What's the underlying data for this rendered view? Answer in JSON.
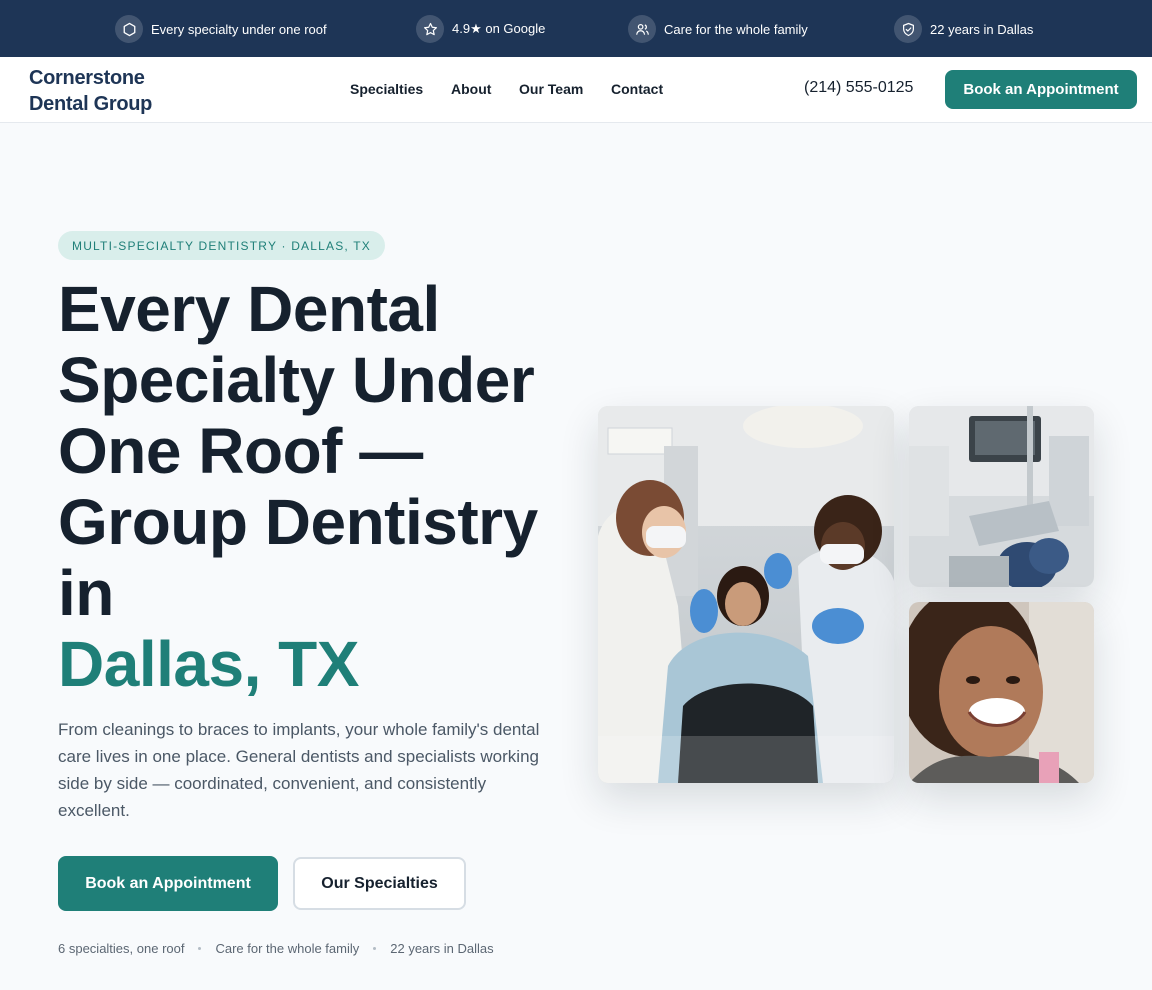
{
  "topbar": {
    "items": [
      {
        "label": "Every specialty under one roof",
        "icon": "hexagon-icon"
      },
      {
        "label": "4.9★ on Google",
        "icon": "star-icon"
      },
      {
        "label": "Care for the whole family",
        "icon": "users-icon"
      },
      {
        "label": "22 years in Dallas",
        "icon": "shield-check-icon"
      }
    ]
  },
  "nav": {
    "logo_line1": "Cornerstone",
    "logo_line2": "Dental Group",
    "links": [
      "Specialties",
      "About",
      "Our Team",
      "Contact"
    ],
    "phone": "(214) 555-0125",
    "cta": "Book an Appointment"
  },
  "hero": {
    "badge": "MULTI-SPECIALTY DENTISTRY · DALLAS, TX",
    "headline": "Every Dental Specialty Under One Roof — Group Dentistry in",
    "headline_accent": "Dallas, TX",
    "lede": "From cleanings to braces to implants, your whole family's dental care lives in one place. General dentists and specialists working side by side — coordinated, convenient, and consistently excellent.",
    "primary_cta": "Book an Appointment",
    "secondary_cta": "Our Specialties",
    "trust": [
      "6 specialties, one roof",
      "Care for the whole family",
      "22 years in Dallas"
    ]
  },
  "colors": {
    "navy": "#1e3556",
    "teal": "#1f7f78",
    "badge_bg": "#d9eeeb",
    "text": "#16212e",
    "muted": "#4b5866"
  }
}
